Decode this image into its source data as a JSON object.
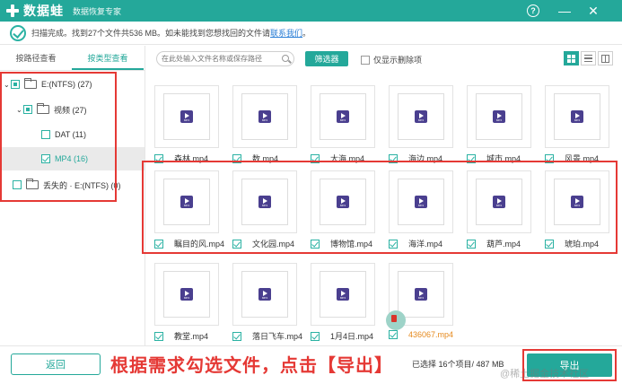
{
  "app": {
    "name": "数据蛙",
    "tagline": "数据恢复专家",
    "window_controls": {
      "help": "?",
      "minimize": "—",
      "close": "✕"
    }
  },
  "scan": {
    "message": "扫描完成。找到27个文件共536 MB。如未能找到您想找回的文件请",
    "link": "联系我们",
    "period": "。"
  },
  "sidebar": {
    "tabs": [
      {
        "label": "按路径查看",
        "active": false
      },
      {
        "label": "按类型查看",
        "active": true
      }
    ],
    "tree": [
      {
        "label": "E:(NTFS) (27)",
        "expanded": true,
        "state": "partial"
      },
      {
        "label": "视频 (27)",
        "expanded": true,
        "state": "partial"
      },
      {
        "label": "DAT (11)",
        "state": "unchecked"
      },
      {
        "label": "MP4 (16)",
        "state": "checked",
        "selected": true
      },
      {
        "label": "丢失的 · E:(NTFS) (0)",
        "state": "unchecked"
      }
    ]
  },
  "toolbar": {
    "search_placeholder": "在此处输入文件名称或保存路径",
    "filter_label": "筛选器",
    "only_deleted_label": "仅显示删除项",
    "views": [
      "grid",
      "list",
      "detail"
    ],
    "active_view": "grid"
  },
  "files": [
    {
      "name": "森林.mp4",
      "checked": true
    },
    {
      "name": "数.mp4",
      "checked": true
    },
    {
      "name": "大海.mp4",
      "checked": true
    },
    {
      "name": "海边.mp4",
      "checked": true
    },
    {
      "name": "城市.mp4",
      "checked": true
    },
    {
      "name": "风景.mp4",
      "checked": true
    },
    {
      "name": "瞩目的风.mp4",
      "checked": true
    },
    {
      "name": "文化园.mp4",
      "checked": true
    },
    {
      "name": "博物馆.mp4",
      "checked": true
    },
    {
      "name": "海洋.mp4",
      "checked": true
    },
    {
      "name": "葫芦.mp4",
      "checked": true
    },
    {
      "name": "琥珀.mp4",
      "checked": true
    },
    {
      "name": "教堂.mp4",
      "checked": true
    },
    {
      "name": "落日飞车.mp4",
      "checked": true
    },
    {
      "name": "1月4日.mp4",
      "checked": true
    },
    {
      "name": "436067.mp4",
      "checked": true,
      "highlight": "orange"
    }
  ],
  "thumb_badge": "MP4",
  "bottom": {
    "back_label": "返回",
    "instruction": "根据需求勾选文件，点击【导出】",
    "selected_text": "已选择 16个项目/ 487 MB",
    "export_label": "导出",
    "watermark": "@稀土掘金技术社区"
  },
  "colors": {
    "accent": "#24a89a",
    "highlight_border": "#e53935",
    "orange_name": "#e68a1e"
  }
}
